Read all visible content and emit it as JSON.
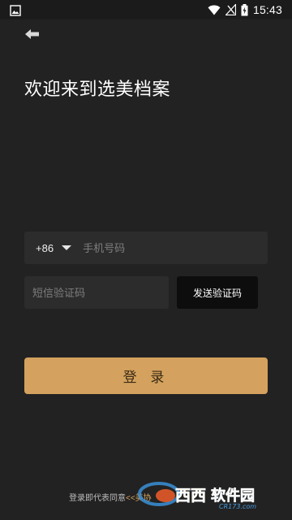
{
  "status_bar": {
    "time": "15:43",
    "icons": [
      "image-icon",
      "wifi-icon",
      "signal-icon",
      "battery-charging-icon"
    ]
  },
  "header": {
    "back_icon": "arrow-left-icon",
    "title": "欢迎来到选美档案"
  },
  "form": {
    "country_code": "+86",
    "phone_placeholder": "手机号码",
    "code_placeholder": "短信验证码",
    "send_code_label": "发送验证码",
    "login_label": "登 录"
  },
  "footer": {
    "agreement_prefix": "登录即代表同意",
    "agreement_link": "<<",
    "agreement_link_partial": "美协"
  },
  "watermark": {
    "text": "西西软件园",
    "domain": "CR173.com"
  },
  "colors": {
    "background": "#222222",
    "accent": "#d4a25e",
    "field": "#2c2c2c",
    "send_button": "#0d0d0d"
  }
}
